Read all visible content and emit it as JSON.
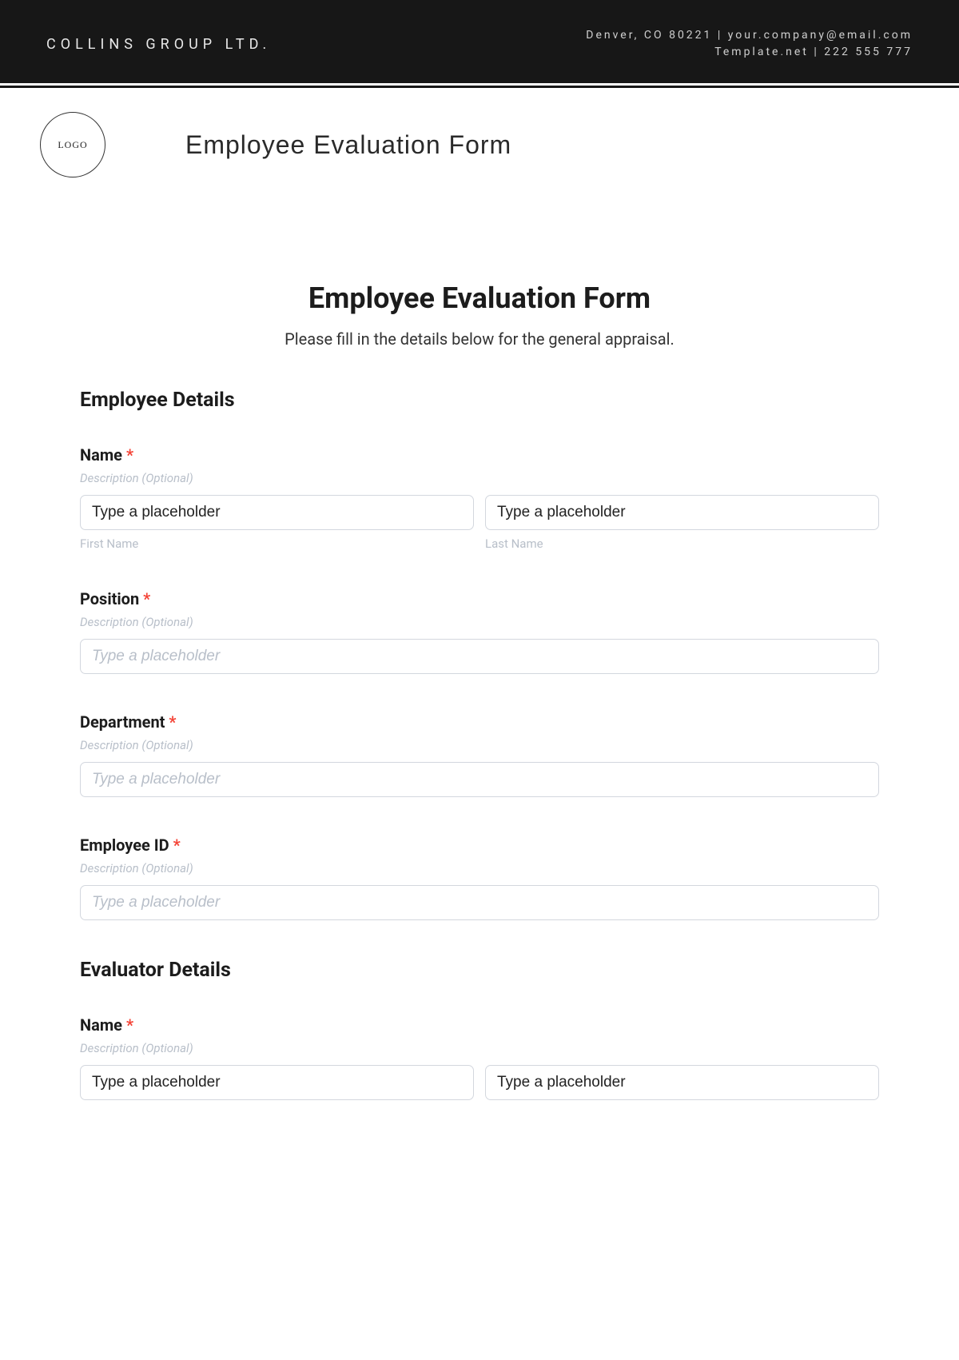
{
  "header": {
    "company": "COLLINS GROUP LTD.",
    "contact_line1": "Denver, CO 80221 | your.company@email.com",
    "contact_line2": "Template.net | 222 555 777",
    "logo_text": "LOGO",
    "doc_title": "Employee Evaluation Form"
  },
  "form": {
    "title": "Employee Evaluation Form",
    "subtitle": "Please fill in the details below for the general appraisal.",
    "desc_optional": "Description (Optional)",
    "placeholder_text": "Type a placeholder",
    "required_mark": "*",
    "sections": {
      "employee": {
        "title": "Employee Details",
        "name": {
          "label": "Name",
          "first_sub": "First Name",
          "last_sub": "Last Name",
          "first_value": "Type a placeholder",
          "last_value": "Type a placeholder"
        },
        "position": {
          "label": "Position"
        },
        "department": {
          "label": "Department"
        },
        "employee_id": {
          "label": "Employee ID"
        }
      },
      "evaluator": {
        "title": "Evaluator Details",
        "name": {
          "label": "Name",
          "first_value": "Type a placeholder",
          "last_value": "Type a placeholder"
        }
      }
    }
  }
}
